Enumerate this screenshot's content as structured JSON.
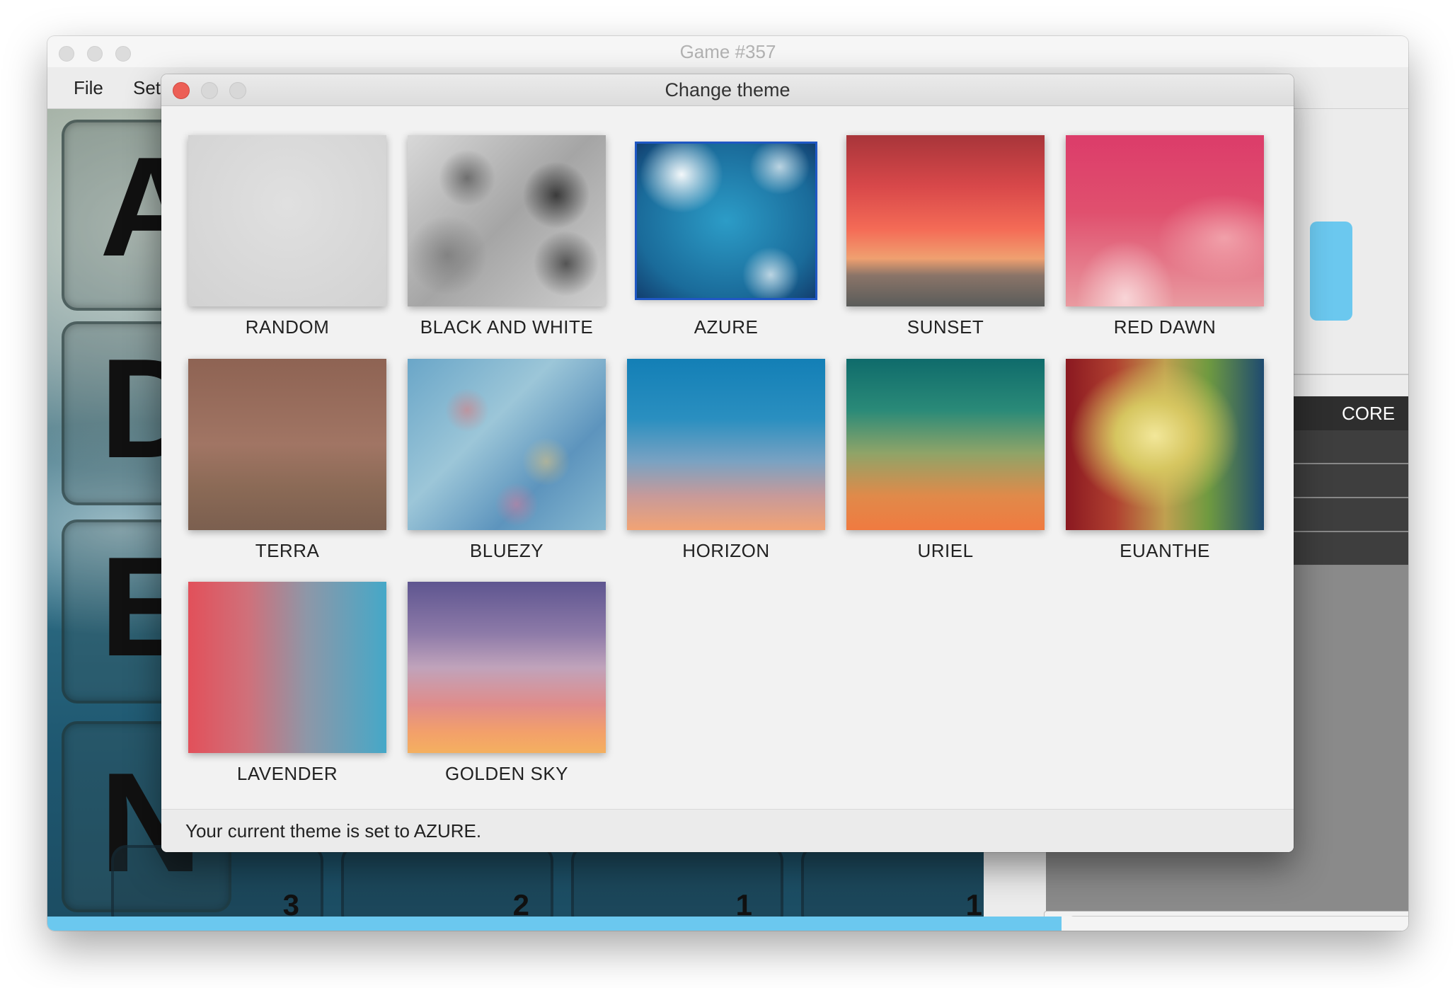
{
  "main_window": {
    "title": "Game #357",
    "menu": {
      "file": "File",
      "settings": "Set"
    },
    "tiles": [
      {
        "letter": "A",
        "score": ""
      },
      {
        "letter": "D",
        "score": ""
      },
      {
        "letter": "E",
        "score": ""
      },
      {
        "letter": "N",
        "score": ""
      }
    ],
    "bottom_tile_scores": [
      "3",
      "2",
      "1",
      "1"
    ],
    "score_header": "CORE",
    "progress_fraction": 0.745
  },
  "dialog": {
    "title": "Change theme",
    "themes": [
      {
        "label": "RANDOM"
      },
      {
        "label": "BLACK AND WHITE"
      },
      {
        "label": "AZURE",
        "selected": true
      },
      {
        "label": "SUNSET"
      },
      {
        "label": "RED DAWN"
      },
      {
        "label": "TERRA"
      },
      {
        "label": "BLUEZY"
      },
      {
        "label": "HORIZON"
      },
      {
        "label": "URIEL"
      },
      {
        "label": "EUANTHE"
      },
      {
        "label": "LAVENDER"
      },
      {
        "label": "GOLDEN SKY"
      }
    ],
    "status": "Your current theme is set to AZURE."
  },
  "colors": {
    "accent": "#6bc8ef",
    "close_button": "#ec5f56",
    "selected_border": "#1f57c4"
  }
}
